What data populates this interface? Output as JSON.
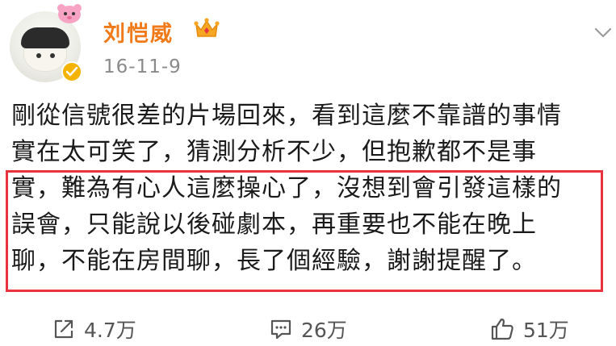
{
  "author": {
    "name": "刘恺威",
    "badge_icon": "crown-icon",
    "verified_icon": "vip-check-icon",
    "accent_color": "#f07a1a"
  },
  "post": {
    "date": "16-11-9",
    "lines": [
      "剛從信號很差的片場回來，看到這麼不靠譜的事情",
      "實在太可笑了，猜測分析不少，但抱歉都不是事",
      "實，難為有心人這麼操心了，沒想到會引發這樣的",
      "誤會，只能說以後碰劇本，再重要也不能在晚上",
      "聊，不能在房間聊，長了個經驗，謝謝提醒了。"
    ],
    "highlight_color": "#e8333f"
  },
  "actions": {
    "share": {
      "icon": "share-icon",
      "count": "4.7万"
    },
    "comment": {
      "icon": "comment-icon",
      "count": "26万"
    },
    "like": {
      "icon": "thumbs-up-icon",
      "count": "51万"
    }
  }
}
